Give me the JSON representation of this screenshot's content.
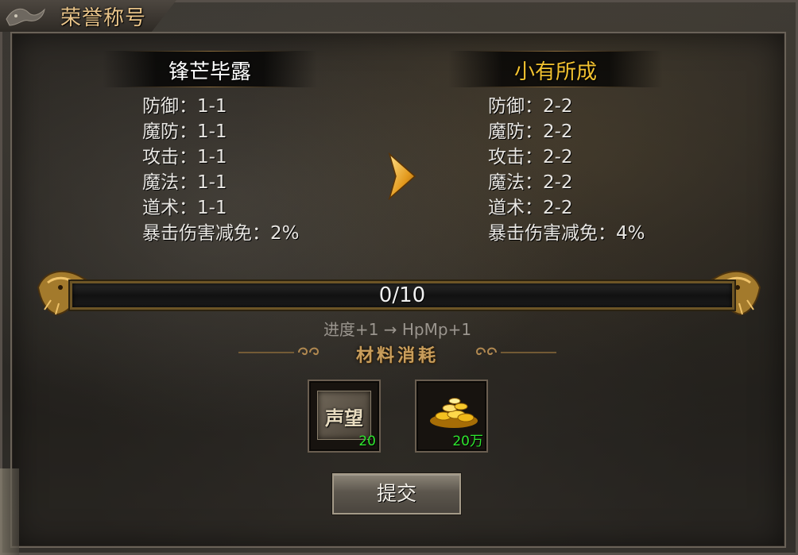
{
  "window": {
    "title": "荣誉称号"
  },
  "current": {
    "name": "锋芒毕露",
    "name_color": "#ffffff",
    "stats": [
      {
        "label": "防御：",
        "value": "1-1"
      },
      {
        "label": "魔防：",
        "value": "1-1"
      },
      {
        "label": "攻击：",
        "value": "1-1"
      },
      {
        "label": "魔法：",
        "value": "1-1"
      },
      {
        "label": "道术：",
        "value": "1-1"
      },
      {
        "label": "暴击伤害减免：",
        "value": "2%"
      }
    ]
  },
  "next": {
    "name": "小有所成",
    "name_color": "#f2c230",
    "stats": [
      {
        "label": "防御：",
        "value": "2-2"
      },
      {
        "label": "魔防：",
        "value": "2-2"
      },
      {
        "label": "攻击：",
        "value": "2-2"
      },
      {
        "label": "魔法：",
        "value": "2-2"
      },
      {
        "label": "道术：",
        "value": "2-2"
      },
      {
        "label": "暴击伤害减免：",
        "value": "4%"
      }
    ]
  },
  "progress": {
    "text": "0/10",
    "current": 0,
    "max": 10
  },
  "bonus": "进度+1 → HpMp+1",
  "materials": {
    "title": "材料消耗",
    "items": [
      {
        "icon": "reputation-icon",
        "icon_text": "声望",
        "quantity": "20"
      },
      {
        "icon": "gold-coins-icon",
        "quantity": "20万"
      }
    ]
  },
  "submit_label": "提交",
  "colors": {
    "accent_gold": "#e9c489",
    "quantity_green": "#2ee62e"
  }
}
